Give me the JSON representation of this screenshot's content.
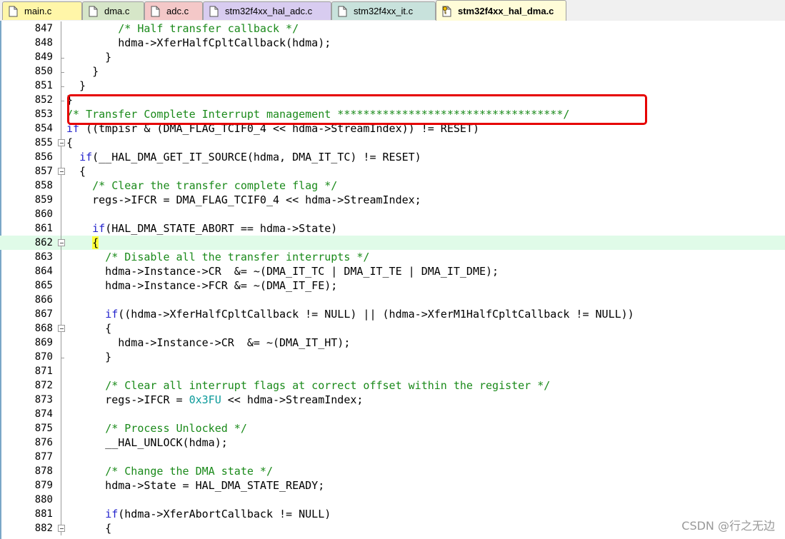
{
  "tabs": [
    {
      "label": "main.c",
      "bg": "#fff6a8",
      "icon": "c-file-icon",
      "active": false
    },
    {
      "label": "dma.c",
      "bg": "#d6e6c8",
      "icon": "c-file-icon",
      "active": false
    },
    {
      "label": "adc.c",
      "bg": "#f4c8c8",
      "icon": "c-file-icon",
      "active": false
    },
    {
      "label": "stm32f4xx_hal_adc.c",
      "bg": "#d8ccf0",
      "icon": "c-file-icon",
      "active": false
    },
    {
      "label": "stm32f4xx_it.c",
      "bg": "#c8e2dc",
      "icon": "c-file-icon",
      "active": false
    },
    {
      "label": "stm32f4xx_hal_dma.c",
      "bg": "#fffcd8",
      "icon": "c-file-key-icon",
      "active": true
    }
  ],
  "code_lines": [
    {
      "n": "847",
      "fold": "line",
      "tokens": [
        [
          "        ",
          ""
        ],
        [
          "/* Half transfer callback */",
          "c-com"
        ]
      ]
    },
    {
      "n": "848",
      "fold": "line",
      "tokens": [
        [
          "        hdma->XferHalfCpltCallback(hdma);",
          ""
        ]
      ]
    },
    {
      "n": "849",
      "fold": "end",
      "tokens": [
        [
          "      }",
          ""
        ]
      ]
    },
    {
      "n": "850",
      "fold": "end",
      "tokens": [
        [
          "    }",
          ""
        ]
      ]
    },
    {
      "n": "851",
      "fold": "end",
      "tokens": [
        [
          "  }",
          ""
        ]
      ]
    },
    {
      "n": "852",
      "fold": "end",
      "tokens": [
        [
          "}",
          ""
        ]
      ]
    },
    {
      "n": "853",
      "fold": "line",
      "tokens": [
        [
          "/* Transfer Complete Interrupt management ***********************************/",
          "c-com"
        ]
      ]
    },
    {
      "n": "854",
      "fold": "line",
      "tokens": [
        [
          "if",
          "c-kw"
        ],
        [
          " ((tmpisr & (DMA_FLAG_TCIF0_4 << hdma->StreamIndex)) != RESET)",
          ""
        ]
      ]
    },
    {
      "n": "855",
      "fold": "box",
      "tokens": [
        [
          "{",
          ""
        ]
      ]
    },
    {
      "n": "856",
      "fold": "line",
      "tokens": [
        [
          "  ",
          ""
        ],
        [
          "if",
          "c-kw"
        ],
        [
          "(__HAL_DMA_GET_IT_SOURCE(hdma, DMA_IT_TC) != RESET)",
          ""
        ]
      ]
    },
    {
      "n": "857",
      "fold": "box",
      "tokens": [
        [
          "  {",
          ""
        ]
      ]
    },
    {
      "n": "858",
      "fold": "line",
      "tokens": [
        [
          "    ",
          ""
        ],
        [
          "/* Clear the transfer complete flag */",
          "c-com"
        ]
      ]
    },
    {
      "n": "859",
      "fold": "line",
      "tokens": [
        [
          "    regs->IFCR = DMA_FLAG_TCIF0_4 << hdma->StreamIndex;",
          ""
        ]
      ]
    },
    {
      "n": "860",
      "fold": "line",
      "tokens": [
        [
          "",
          ""
        ]
      ]
    },
    {
      "n": "861",
      "fold": "line",
      "tokens": [
        [
          "    ",
          ""
        ],
        [
          "if",
          "c-kw"
        ],
        [
          "(HAL_DMA_STATE_ABORT == hdma->State)",
          ""
        ]
      ]
    },
    {
      "n": "862",
      "fold": "box",
      "hl": true,
      "tokens": [
        [
          "    ",
          ""
        ],
        [
          "{",
          "brace-hl"
        ]
      ]
    },
    {
      "n": "863",
      "fold": "line",
      "tokens": [
        [
          "      ",
          ""
        ],
        [
          "/* Disable all the transfer interrupts */",
          "c-com"
        ]
      ]
    },
    {
      "n": "864",
      "fold": "line",
      "tokens": [
        [
          "      hdma->Instance->CR  &= ~(DMA_IT_TC | DMA_IT_TE | DMA_IT_DME);",
          ""
        ]
      ]
    },
    {
      "n": "865",
      "fold": "line",
      "tokens": [
        [
          "      hdma->Instance->FCR &= ~(DMA_IT_FE);",
          ""
        ]
      ]
    },
    {
      "n": "866",
      "fold": "line",
      "tokens": [
        [
          "",
          ""
        ]
      ]
    },
    {
      "n": "867",
      "fold": "line",
      "tokens": [
        [
          "      ",
          ""
        ],
        [
          "if",
          "c-kw"
        ],
        [
          "((hdma->XferHalfCpltCallback != NULL) || (hdma->XferM1HalfCpltCallback != NULL))",
          ""
        ]
      ]
    },
    {
      "n": "868",
      "fold": "box",
      "tokens": [
        [
          "      {",
          ""
        ]
      ]
    },
    {
      "n": "869",
      "fold": "line",
      "tokens": [
        [
          "        hdma->Instance->CR  &= ~(DMA_IT_HT);",
          ""
        ]
      ]
    },
    {
      "n": "870",
      "fold": "end",
      "tokens": [
        [
          "      }",
          ""
        ]
      ]
    },
    {
      "n": "871",
      "fold": "line",
      "tokens": [
        [
          "",
          ""
        ]
      ]
    },
    {
      "n": "872",
      "fold": "line",
      "tokens": [
        [
          "      ",
          ""
        ],
        [
          "/* Clear all interrupt flags at correct offset within the register */",
          "c-com"
        ]
      ]
    },
    {
      "n": "873",
      "fold": "line",
      "tokens": [
        [
          "      regs->IFCR = ",
          ""
        ],
        [
          "0x3FU",
          "c-num"
        ],
        [
          " << hdma->StreamIndex;",
          ""
        ]
      ]
    },
    {
      "n": "874",
      "fold": "line",
      "tokens": [
        [
          "",
          ""
        ]
      ]
    },
    {
      "n": "875",
      "fold": "line",
      "tokens": [
        [
          "      ",
          ""
        ],
        [
          "/* Process Unlocked */",
          "c-com"
        ]
      ]
    },
    {
      "n": "876",
      "fold": "line",
      "tokens": [
        [
          "      __HAL_UNLOCK(hdma);",
          ""
        ]
      ]
    },
    {
      "n": "877",
      "fold": "line",
      "tokens": [
        [
          "",
          ""
        ]
      ]
    },
    {
      "n": "878",
      "fold": "line",
      "tokens": [
        [
          "      ",
          ""
        ],
        [
          "/* Change the DMA state */",
          "c-com"
        ]
      ]
    },
    {
      "n": "879",
      "fold": "line",
      "tokens": [
        [
          "      hdma->State = HAL_DMA_STATE_READY;",
          ""
        ]
      ]
    },
    {
      "n": "880",
      "fold": "line",
      "tokens": [
        [
          "",
          ""
        ]
      ]
    },
    {
      "n": "881",
      "fold": "line",
      "tokens": [
        [
          "      ",
          ""
        ],
        [
          "if",
          "c-kw"
        ],
        [
          "(hdma->XferAbortCallback != NULL)",
          ""
        ]
      ]
    },
    {
      "n": "882",
      "fold": "box",
      "tokens": [
        [
          "      {",
          ""
        ]
      ]
    }
  ],
  "watermark": "CSDN @行之无边"
}
